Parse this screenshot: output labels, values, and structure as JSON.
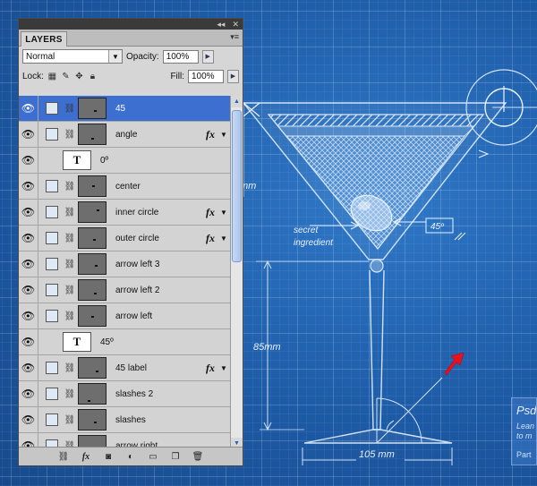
{
  "panel": {
    "tab_label": "LAYERS",
    "collapse_glyph": "◂◂",
    "close_glyph": "✕",
    "menu_glyph": "▾≡",
    "blend_mode": "Normal",
    "opacity_label": "Opacity:",
    "opacity_value": "100%",
    "lock_label": "Lock:",
    "fill_label": "Fill:",
    "fill_value": "100%",
    "layers": [
      {
        "name": "45",
        "type": "shape",
        "selected": true,
        "fx": false
      },
      {
        "name": "angle",
        "type": "shape",
        "selected": false,
        "fx": true
      },
      {
        "name": "0º",
        "type": "text",
        "selected": false,
        "fx": false
      },
      {
        "name": "center",
        "type": "shape",
        "selected": false,
        "fx": false
      },
      {
        "name": "inner circle",
        "type": "shape",
        "selected": false,
        "fx": true
      },
      {
        "name": "outer circle",
        "type": "shape",
        "selected": false,
        "fx": true
      },
      {
        "name": "arrow left 3",
        "type": "shape",
        "selected": false,
        "fx": false
      },
      {
        "name": "arrow left 2",
        "type": "shape",
        "selected": false,
        "fx": false
      },
      {
        "name": "arrow left",
        "type": "shape",
        "selected": false,
        "fx": false
      },
      {
        "name": "45º",
        "type": "text",
        "selected": false,
        "fx": false
      },
      {
        "name": "45 label",
        "type": "shape",
        "selected": false,
        "fx": true
      },
      {
        "name": "slashes 2",
        "type": "shape",
        "selected": false,
        "fx": false
      },
      {
        "name": "slashes",
        "type": "shape",
        "selected": false,
        "fx": false
      },
      {
        "name": "arrow right",
        "type": "shape",
        "selected": false,
        "fx": false
      }
    ],
    "text_thumb_glyph": "T",
    "fx_glyph": "fx",
    "bottom_icons": [
      "link-icon",
      "fx-icon",
      "mask-icon",
      "adjustment-icon",
      "folder-icon",
      "new-layer-icon",
      "trash-icon"
    ]
  },
  "blueprint": {
    "label_mm_left": "mm",
    "label_secret": "secret",
    "label_ingredient": "ingredient",
    "label_angle": "45º",
    "label_height": "85mm",
    "label_width": "105 mm",
    "accent_color": "#1c5aa6",
    "arrow_color": "#e8121c"
  },
  "promo": {
    "title": "Psd",
    "line1": "Lean",
    "line2": "to m",
    "footer": "Part"
  }
}
